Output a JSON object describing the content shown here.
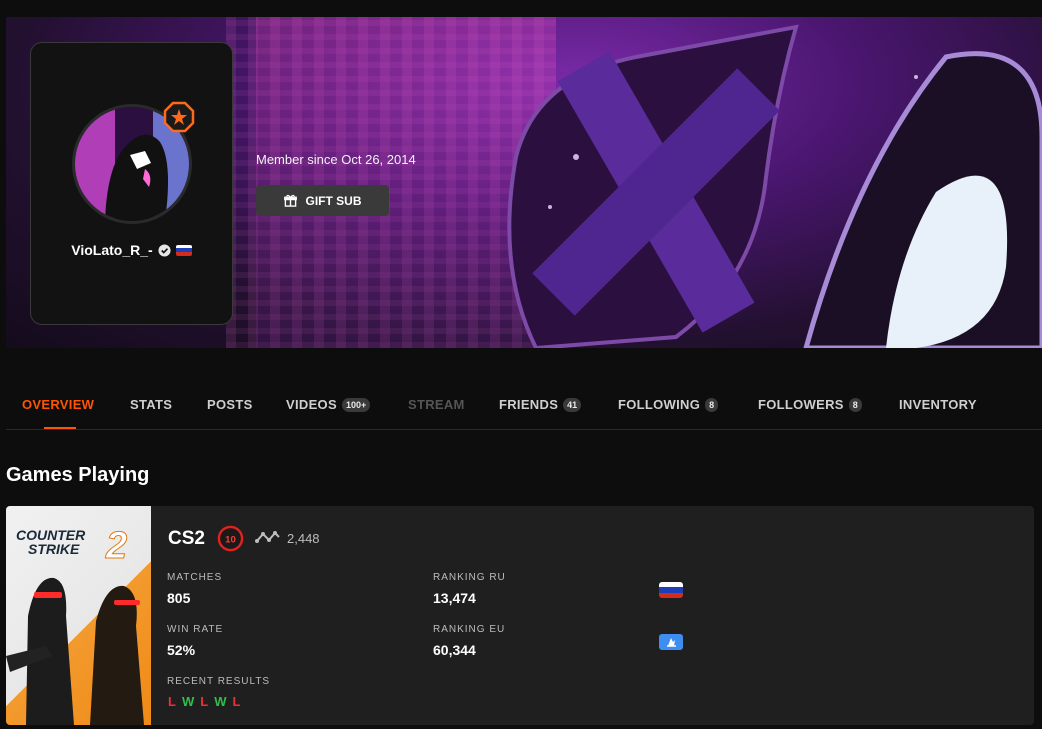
{
  "profile": {
    "username": "VioLato_R_-",
    "member_since": "Member since Oct 26, 2014",
    "gift_button_label": "GIFT SUB",
    "icons": {
      "verified": "verified-check-icon",
      "country": "russia-flag-icon",
      "gift": "gift-icon",
      "level": "star-level-badge-icon"
    }
  },
  "tabs": [
    {
      "label": "OVERVIEW",
      "active": true
    },
    {
      "label": "STATS"
    },
    {
      "label": "POSTS"
    },
    {
      "label": "VIDEOS",
      "count": "100+"
    },
    {
      "label": "STREAM",
      "disabled": true
    },
    {
      "label": "FRIENDS",
      "count": "41"
    },
    {
      "label": "FOLLOWING",
      "count": "8"
    },
    {
      "label": "FOLLOWERS",
      "count": "8"
    },
    {
      "label": "INVENTORY"
    }
  ],
  "games_section": {
    "title": "Games Playing",
    "game": {
      "cover_title_line1": "COUNTER",
      "cover_title_line2": "STRIKE",
      "cover_title_number": "2",
      "name": "CS2",
      "level": "10",
      "elo": "2,448",
      "stats": {
        "matches_label": "MATCHES",
        "matches_value": "805",
        "win_rate_label": "WIN RATE",
        "win_rate_value": "52%",
        "recent_results_label": "RECENT RESULTS",
        "ranking_ru_label": "RANKING RU",
        "ranking_ru_value": "13,474",
        "ranking_eu_label": "RANKING EU",
        "ranking_eu_value": "60,344"
      },
      "recent_results": [
        "L",
        "W",
        "L",
        "W",
        "L"
      ]
    }
  },
  "colors": {
    "accent": "#ff5500",
    "win": "#2ec04a",
    "loss": "#f22b3b",
    "card_bg": "#1f1f1f",
    "page_bg": "#0d0d0d"
  }
}
